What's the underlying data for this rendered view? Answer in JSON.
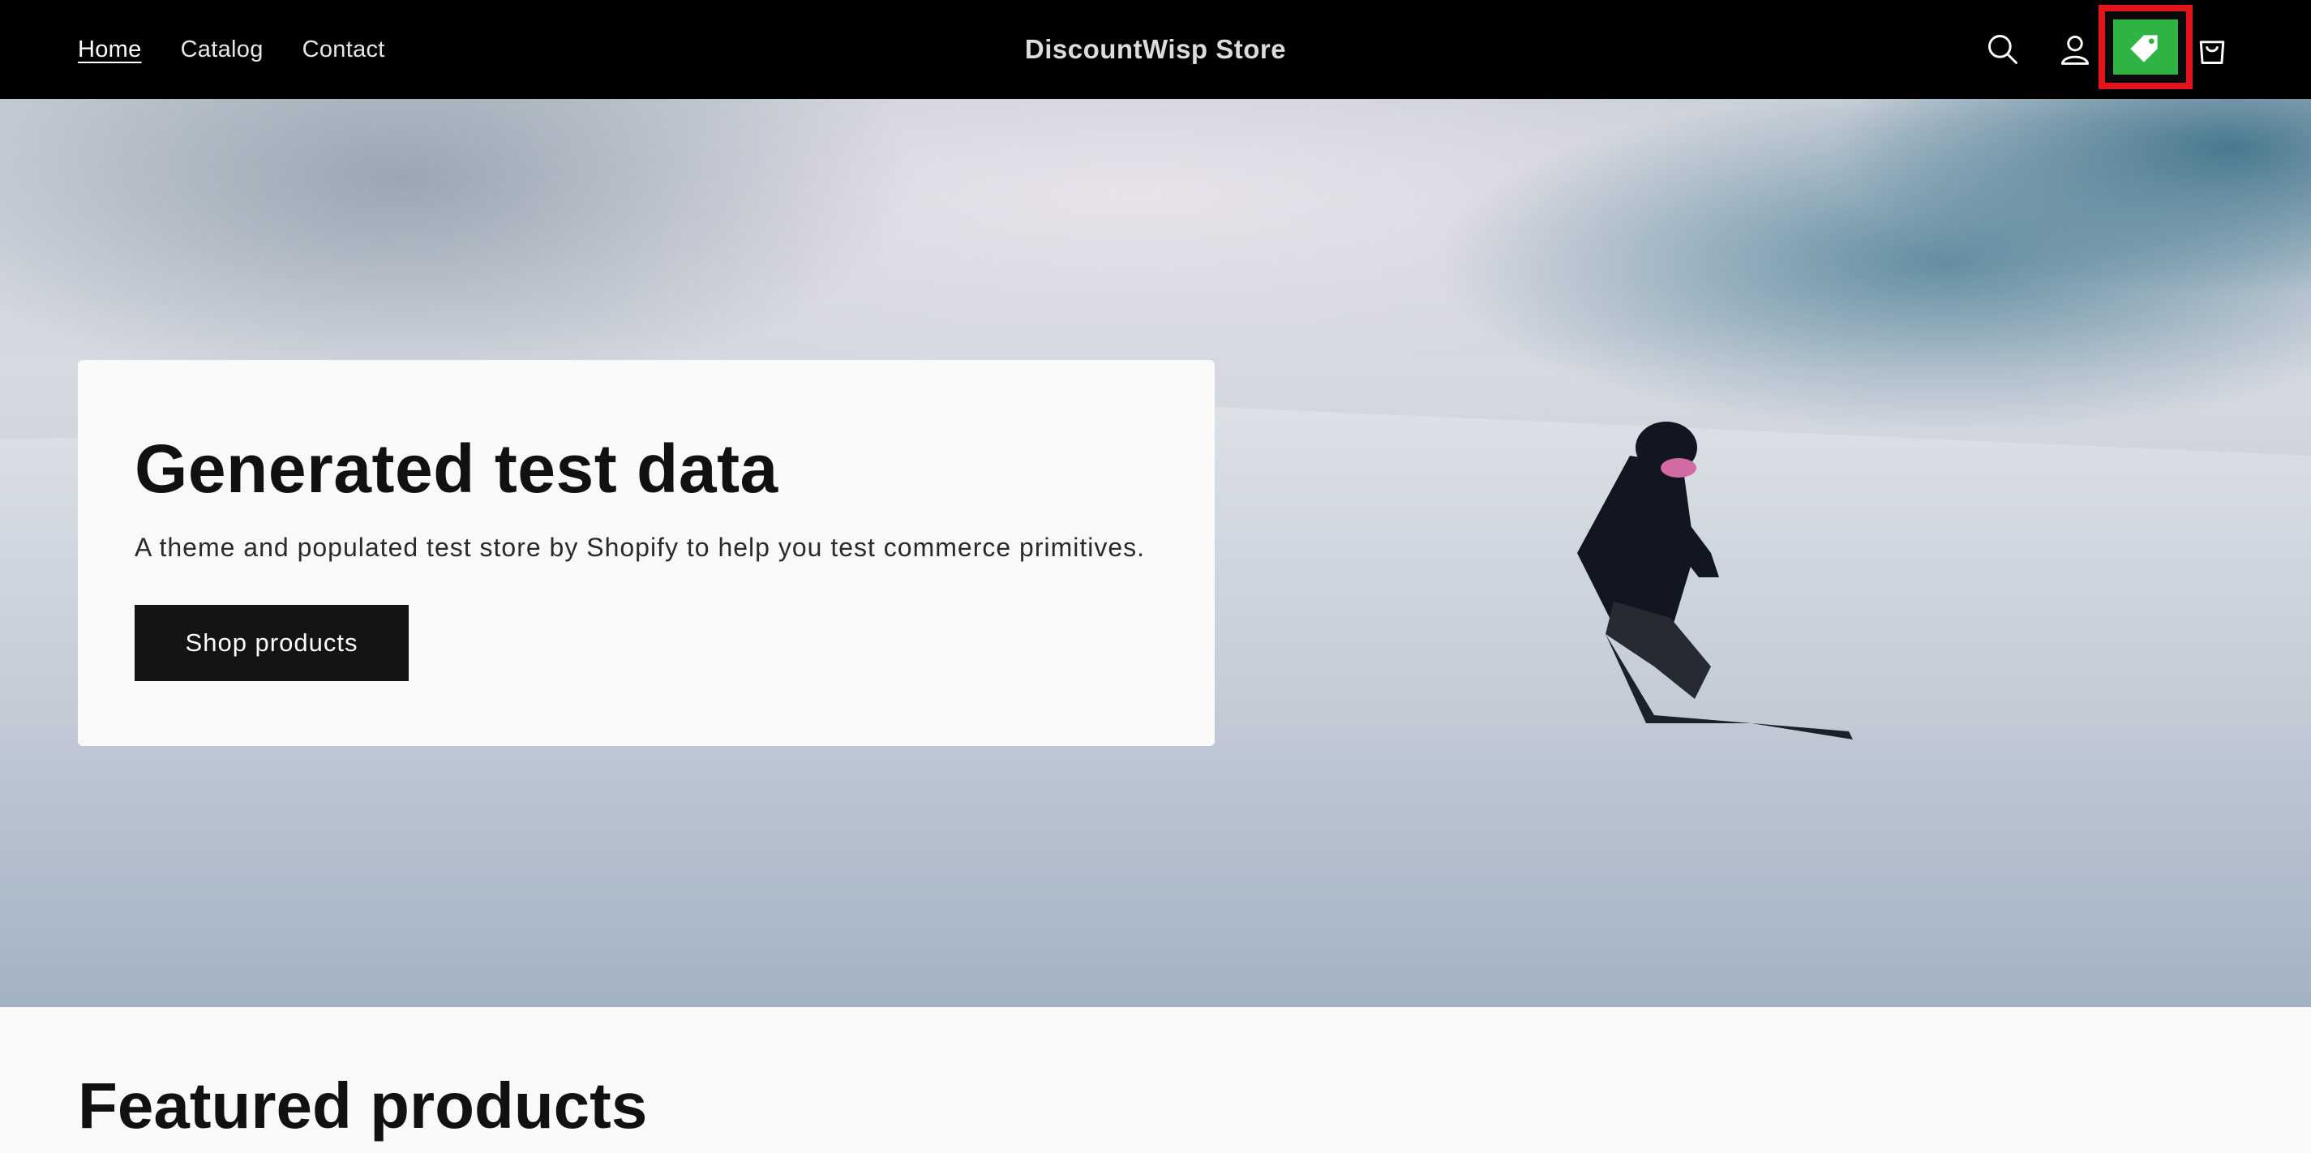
{
  "header": {
    "nav": [
      {
        "label": "Home",
        "active": true
      },
      {
        "label": "Catalog",
        "active": false
      },
      {
        "label": "Contact",
        "active": false
      }
    ],
    "brand": "DiscountWisp Store",
    "icons": [
      "search-icon",
      "account-icon",
      "discount-tag-icon",
      "cart-icon"
    ],
    "highlight_color": "#e3141b",
    "tag_bg_color": "#2fb344"
  },
  "hero": {
    "title": "Generated test data",
    "subtitle": "A theme and populated test store by Shopify to help you test commerce primitives.",
    "button_label": "Shop products"
  },
  "featured": {
    "title": "Featured products"
  }
}
